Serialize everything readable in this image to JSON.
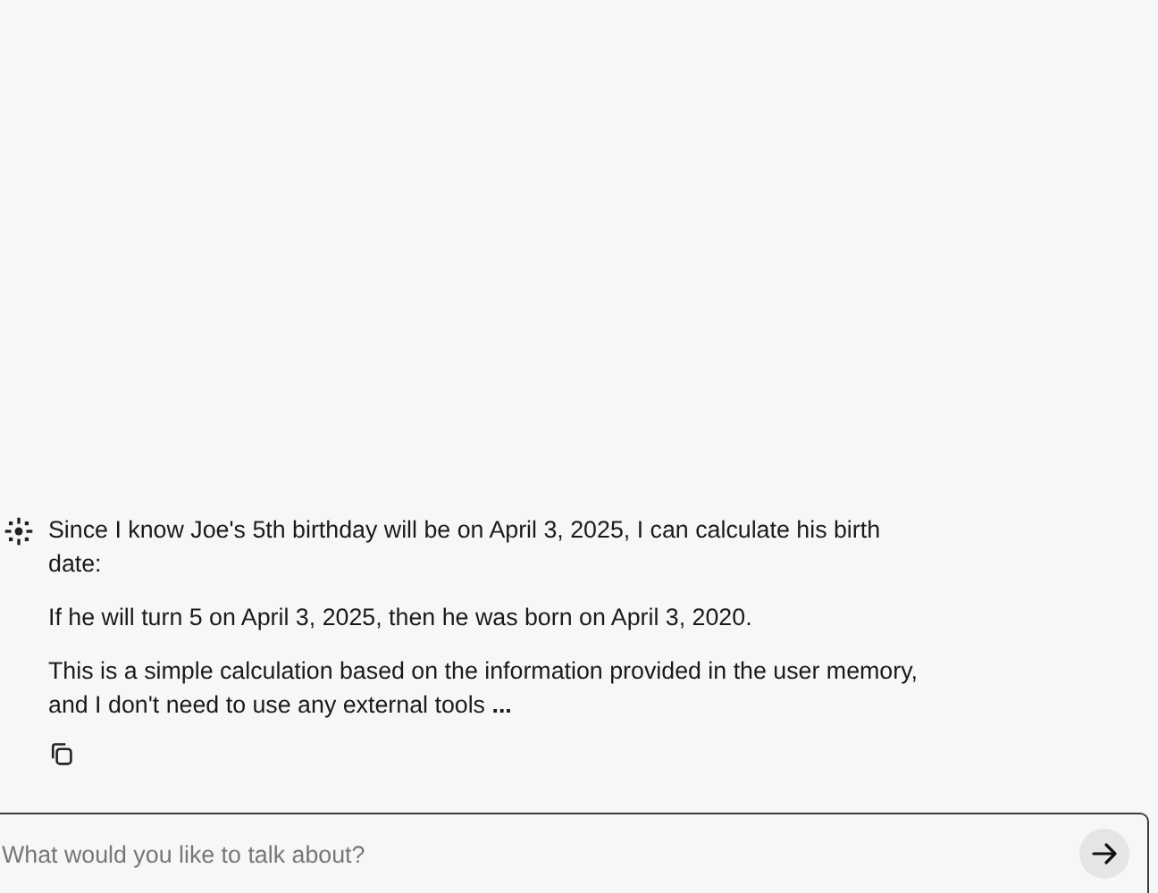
{
  "message": {
    "paragraphs": [
      "Since I know Joe's 5th birthday will be on April 3, 2025, I can calculate his birth date:",
      "If he will turn 5 on April 3, 2025, then he was born on April 3, 2020.",
      "This is a simple calculation based on the information provided in the user memory, and I don't need to use any external tools **...**"
    ]
  },
  "composer": {
    "placeholder": "What would you like to talk about?"
  }
}
